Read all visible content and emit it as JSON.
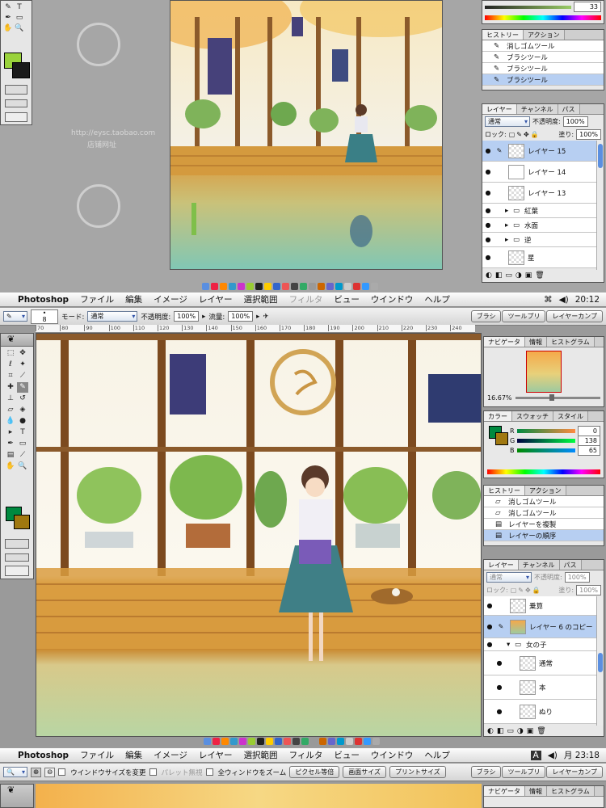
{
  "screen1": {
    "watermark_url": "http://eysc.taobao.com",
    "watermark_sub": "店铺网址",
    "swatch_value": "33",
    "history": {
      "tabs": [
        "ヒストリー",
        "アクション"
      ],
      "items": [
        "消しゴムツール",
        "ブラシツール",
        "ブラシツール",
        "ブラシツール"
      ]
    },
    "layers": {
      "tabs": [
        "レイヤー",
        "チャンネル",
        "パス"
      ],
      "mode": "通常",
      "opacity_label": "不透明度:",
      "opacity": "100%",
      "lock_label": "ロック:",
      "fill_label": "塗り:",
      "fill": "100%",
      "items": [
        {
          "name": "レイヤー 15",
          "type": "layer"
        },
        {
          "name": "レイヤー 14",
          "type": "layer"
        },
        {
          "name": "レイヤー 13",
          "type": "layer"
        },
        {
          "name": "紅葉",
          "type": "group"
        },
        {
          "name": "水面",
          "type": "group"
        },
        {
          "name": "逆",
          "type": "group"
        },
        {
          "name": "星",
          "type": "layer"
        }
      ]
    }
  },
  "screen2": {
    "menubar": {
      "app": "Photoshop",
      "items": [
        "ファイル",
        "編集",
        "イメージ",
        "レイヤー",
        "選択範囲",
        "フィルタ",
        "ビュー",
        "ウインドウ",
        "ヘルプ"
      ],
      "clock": "20:12"
    },
    "options": {
      "brush_size": "8",
      "mode_label": "モード:",
      "mode": "通常",
      "opacity_label": "不透明度:",
      "opacity": "100%",
      "flow_label": "流量:",
      "flow": "100%",
      "wells": [
        "ブラシ",
        "ツールプリ",
        "レイヤーカンプ"
      ]
    },
    "ruler_ticks": [
      "70",
      "80",
      "90",
      "100",
      "110",
      "120",
      "130",
      "140",
      "150",
      "160",
      "170",
      "180",
      "190",
      "200",
      "210",
      "220",
      "230",
      "240"
    ],
    "navigator": {
      "tabs": [
        "ナビゲータ",
        "情報",
        "ヒストグラム"
      ],
      "zoom": "16.67%"
    },
    "color": {
      "tabs": [
        "カラー",
        "スウォッチ",
        "スタイル"
      ],
      "r_label": "R",
      "r": "0",
      "g_label": "G",
      "g": "138",
      "b_label": "B",
      "b": "65",
      "fg": "#00893f",
      "bg": "#a07810"
    },
    "history": {
      "tabs": [
        "ヒストリー",
        "アクション"
      ],
      "items": [
        "消しゴムツール",
        "消しゴムツール",
        "レイヤーを複製",
        "レイヤーの順序"
      ]
    },
    "layers": {
      "tabs": [
        "レイヤー",
        "チャンネル",
        "パス"
      ],
      "mode": "通常",
      "opacity_label": "不透明度:",
      "opacity": "100%",
      "lock_label": "ロック:",
      "fill_label": "塗り:",
      "fill": "100%",
      "items": [
        {
          "name": "乗算",
          "type": "layer"
        },
        {
          "name": "レイヤー 6 のコピー",
          "type": "layer"
        },
        {
          "name": "女の子",
          "type": "group"
        },
        {
          "name": "通常",
          "type": "layer"
        },
        {
          "name": "本",
          "type": "layer"
        },
        {
          "name": "ぬり",
          "type": "layer"
        }
      ]
    }
  },
  "screen3": {
    "menubar": {
      "app": "Photoshop",
      "items": [
        "ファイル",
        "編集",
        "イメージ",
        "レイヤー",
        "選択範囲",
        "フィルタ",
        "ビュー",
        "ウインドウ",
        "ヘルプ"
      ],
      "input_indicator": "A",
      "clock": "月 23:18"
    },
    "options": {
      "fit_window": "ウインドウサイズを変更",
      "ignore_palettes": "パレット無視",
      "zoom_all": "全ウィンドウをズーム",
      "actual_pixels": "ピクセル等倍",
      "fit_screen": "画面サイズ",
      "print_size": "プリントサイズ",
      "wells": [
        "ブラシ",
        "ツールプリ",
        "レイヤーカンプ"
      ]
    },
    "navigator_tabs": [
      "ナビゲータ",
      "情報",
      "ヒストグラム"
    ]
  }
}
